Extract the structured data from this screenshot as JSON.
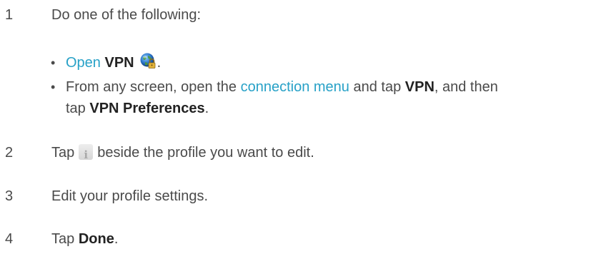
{
  "steps": [
    {
      "number": "1",
      "text": "Do one of the following:"
    },
    {
      "number": "2",
      "pre": "Tap",
      "icon": "info-icon",
      "icon_glyph": "i",
      "post": "beside the profile you want to edit."
    },
    {
      "number": "3",
      "text": "Edit your profile settings."
    },
    {
      "number": "4",
      "pre": "Tap",
      "bold": "Done",
      "post": "."
    }
  ],
  "bullets": [
    {
      "marker": "•",
      "link": "Open",
      "bold": "VPN",
      "icon": "vpn-globe-lock-icon",
      "post": "."
    },
    {
      "marker": "•",
      "line1_pre": "From any screen, open the",
      "line1_link": "connection menu",
      "line1_mid": "and tap",
      "line1_bold": "VPN",
      "line1_post": ", and then",
      "line2_pre": "tap",
      "line2_bold": "VPN Preferences",
      "line2_post": "."
    }
  ],
  "colors": {
    "link": "#27a1c7",
    "text": "#4a4a4a",
    "bold": "#222222"
  }
}
